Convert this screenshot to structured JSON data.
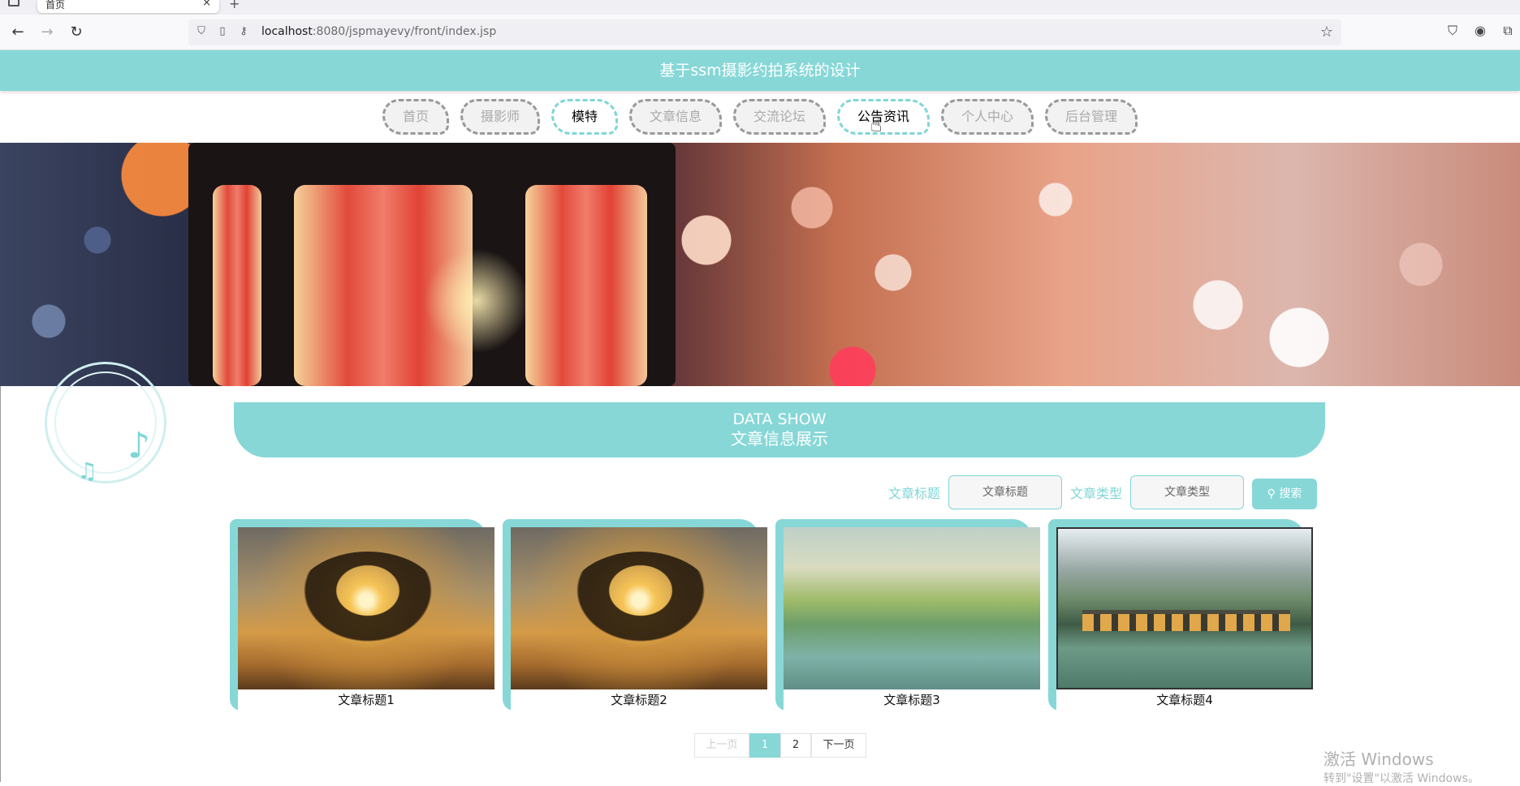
{
  "browser": {
    "tab_title": "首页",
    "tab_close": "×",
    "new_tab": "+",
    "url_host": "localhost",
    "url_path": ":8080/jspmayevy/front/index.jsp",
    "back": "←",
    "forward": "→",
    "reload": "↻",
    "star": "☆"
  },
  "site": {
    "title": "基于ssm摄影约拍系统的设计"
  },
  "nav": {
    "items": [
      "首页",
      "摄影师",
      "模特",
      "文章信息",
      "交流论坛",
      "公告资讯",
      "个人中心",
      "后台管理"
    ],
    "active": [
      "模特",
      "公告资讯"
    ]
  },
  "section": {
    "en": "DATA SHOW",
    "zh": "文章信息展示"
  },
  "search": {
    "title_label": "文章标题",
    "title_placeholder": "文章标题",
    "type_label": "文章类型",
    "type_placeholder": "文章类型",
    "button": "搜索"
  },
  "cards": [
    {
      "caption": "文章标题1"
    },
    {
      "caption": "文章标题2"
    },
    {
      "caption": "文章标题3"
    },
    {
      "caption": "文章标题4"
    }
  ],
  "pager": {
    "prev": "上一页",
    "pages": [
      "1",
      "2"
    ],
    "current": "1",
    "next": "下一页"
  },
  "watermark": {
    "line1": "激活 Windows",
    "line2": "转到\"设置\"以激活 Windows。"
  },
  "colors": {
    "accent": "#87d7d7"
  }
}
